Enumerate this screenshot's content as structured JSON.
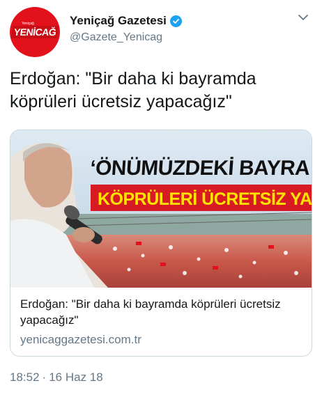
{
  "account": {
    "display_name": "Yeniçağ Gazetesi",
    "handle": "@Gazete_Yenicag",
    "avatar_text": "YENİCAĞ",
    "avatar_small_text": "Yeniçağ",
    "verified_icon": "verified-badge-icon",
    "brand_color": "#e3111b"
  },
  "tweet": {
    "text": "Erdoğan: \"Bir daha ki bayramda köprüleri ücretsiz yapacağız\""
  },
  "card": {
    "image_headline_line1": "‘ÖNÜMÜZDEKİ BAYRA",
    "image_headline_line2": "KÖPRÜLERİ ÜCRETSİZ YAPA",
    "title": "Erdoğan: \"Bir daha ki bayramda köprüleri ücretsiz yapacağız\"",
    "domain": "yenicaggazetesi.com.tr"
  },
  "meta": {
    "time": "18:52",
    "separator": "·",
    "date": "16 Haz 18"
  }
}
